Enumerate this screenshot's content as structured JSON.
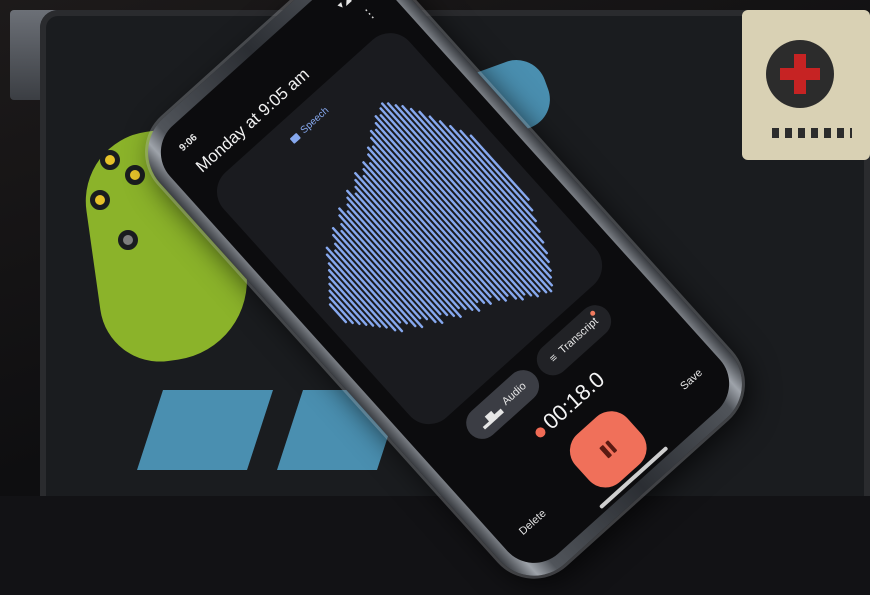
{
  "status_bar": {
    "time": "9:06",
    "icons": "▾◢▮"
  },
  "header": {
    "title": "Monday at 9:05 am"
  },
  "waveform": {
    "label": "Speech",
    "color": "#86a8ee",
    "levels": [
      0.1,
      0.14,
      0.18,
      0.22,
      0.26,
      0.3,
      0.34,
      0.4,
      0.44,
      0.38,
      0.42,
      0.48,
      0.52,
      0.46,
      0.5,
      0.56,
      0.6,
      0.54,
      0.58,
      0.62,
      0.66,
      0.6,
      0.64,
      0.68,
      0.72,
      0.66,
      0.7,
      0.74,
      0.7,
      0.76,
      0.8,
      0.78,
      0.84,
      0.88,
      0.86,
      0.9,
      0.94,
      0.92,
      0.96,
      0.98,
      0.95,
      0.9,
      0.86,
      0.8,
      0.74,
      0.66,
      0.58,
      0.5,
      0.42,
      0.34
    ]
  },
  "tabs": [
    {
      "label": "Audio",
      "icon": "waveform-icon",
      "active": true
    },
    {
      "label": "Transcript",
      "icon": "lines-icon",
      "active": false,
      "has_badge": true
    }
  ],
  "recording": {
    "elapsed": "00:18.0",
    "accent": "#f06b55"
  },
  "controls": {
    "delete_label": "Delete",
    "save_label": "Save",
    "pause_color": "#f0705a"
  }
}
